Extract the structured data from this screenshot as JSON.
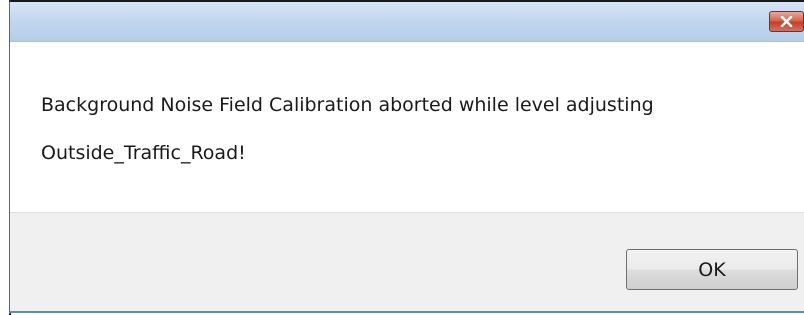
{
  "dialog": {
    "title": "",
    "message_line1": "Background Noise Field Calibration aborted while level adjusting",
    "message_line2": "Outside_Traffic_Road!",
    "ok_label": "OK",
    "close_icon": "close-x-icon"
  },
  "colors": {
    "titlebar": "#c3d8ef",
    "close_button": "#c3402a",
    "footer": "#f0f0f0"
  }
}
